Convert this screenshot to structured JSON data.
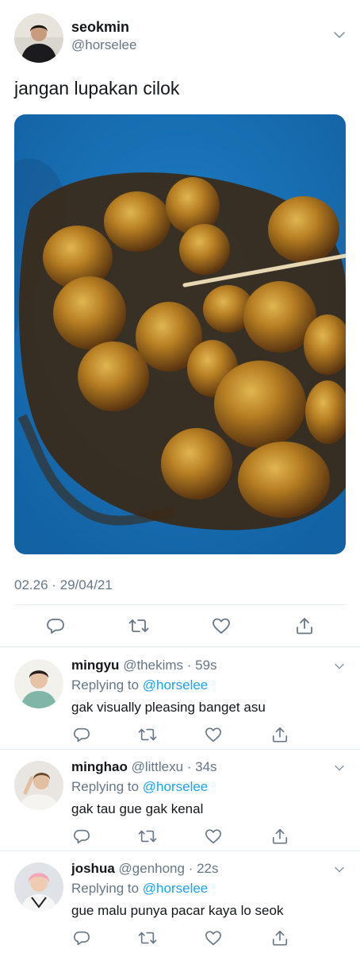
{
  "tweet": {
    "author_name": "seokmin",
    "author_handle": "@horselee",
    "text": "jangan lupakan cilok",
    "timestamp": "02.26 · 29/04/21",
    "photo_icon": "food-photo"
  },
  "replies": [
    {
      "name": "mingyu",
      "handle": "@thekims",
      "time": "59s",
      "replying_label": "Replying to",
      "replying_to": "@horselee",
      "text": "gak visually pleasing banget asu"
    },
    {
      "name": "minghao",
      "handle": "@littlexu",
      "time": "34s",
      "replying_label": "Replying to",
      "replying_to": "@horselee",
      "text": "gak tau gue gak kenal"
    },
    {
      "name": "joshua",
      "handle": "@genhong",
      "time": "22s",
      "replying_label": "Replying to",
      "replying_to": "@horselee",
      "text": "gue malu punya pacar kaya lo seok"
    }
  ],
  "colors": {
    "text_primary": "#14171a",
    "text_secondary": "#657786",
    "link": "#1da1f2",
    "divider": "#e6ecf0",
    "icon": "#657786"
  },
  "icons": {
    "reply": "speech-bubble-icon",
    "retweet": "retweet-icon",
    "like": "heart-icon",
    "share": "share-icon",
    "more": "chevron-down-icon"
  }
}
